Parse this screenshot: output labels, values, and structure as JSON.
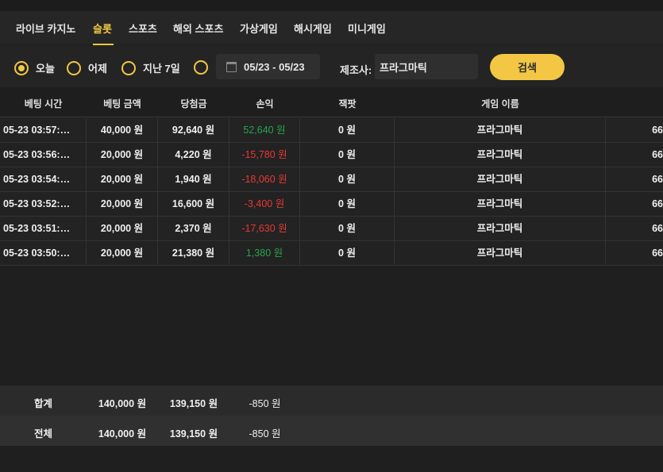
{
  "tabs": [
    {
      "label": "라이브 카지노"
    },
    {
      "label": "슬롯"
    },
    {
      "label": "스포츠"
    },
    {
      "label": "해외 스포츠"
    },
    {
      "label": "가상게임"
    },
    {
      "label": "해시게임"
    },
    {
      "label": "미니게임"
    }
  ],
  "filters": {
    "today": "오늘",
    "yesterday": "어제",
    "last7": "지난 7일",
    "date_range": "05/23 - 05/23",
    "provider_label": "제조사:",
    "provider_value": "프라그마틱",
    "search_label": "검색"
  },
  "table": {
    "headers": [
      "베팅 시간",
      "베팅 금액",
      "당첨금",
      "손익",
      "잭팟",
      "게임 이름"
    ],
    "rows": [
      {
        "time": "05-23 03:57:…",
        "bet": "40,000 원",
        "win": "92,640 원",
        "profit": "52,640 원",
        "profit_sign": "pos",
        "jackpot": "0 원",
        "game": "프라그마틱",
        "extra": "66"
      },
      {
        "time": "05-23 03:56:…",
        "bet": "20,000 원",
        "win": "4,220 원",
        "profit": "-15,780 원",
        "profit_sign": "neg",
        "jackpot": "0 원",
        "game": "프라그마틱",
        "extra": "66"
      },
      {
        "time": "05-23 03:54:…",
        "bet": "20,000 원",
        "win": "1,940 원",
        "profit": "-18,060 원",
        "profit_sign": "neg",
        "jackpot": "0 원",
        "game": "프라그마틱",
        "extra": "66"
      },
      {
        "time": "05-23 03:52:…",
        "bet": "20,000 원",
        "win": "16,600 원",
        "profit": "-3,400 원",
        "profit_sign": "neg",
        "jackpot": "0 원",
        "game": "프라그마틱",
        "extra": "66"
      },
      {
        "time": "05-23 03:51:…",
        "bet": "20,000 원",
        "win": "2,370 원",
        "profit": "-17,630 원",
        "profit_sign": "neg",
        "jackpot": "0 원",
        "game": "프라그마틱",
        "extra": "66"
      },
      {
        "time": "05-23 03:50:…",
        "bet": "20,000 원",
        "win": "21,380 원",
        "profit": "1,380 원",
        "profit_sign": "pos",
        "jackpot": "0 원",
        "game": "프라그마틱",
        "extra": "66"
      }
    ]
  },
  "summary": {
    "subtotal": {
      "label": "합계",
      "bet": "140,000 원",
      "win": "139,150 원",
      "profit": "-850 원"
    },
    "total": {
      "label": "전체",
      "bet": "140,000 원",
      "win": "139,150 원",
      "profit": "-850 원"
    }
  },
  "colors": {
    "accent": "#f3c744",
    "positive": "#2aa34a",
    "negative": "#e53935"
  }
}
